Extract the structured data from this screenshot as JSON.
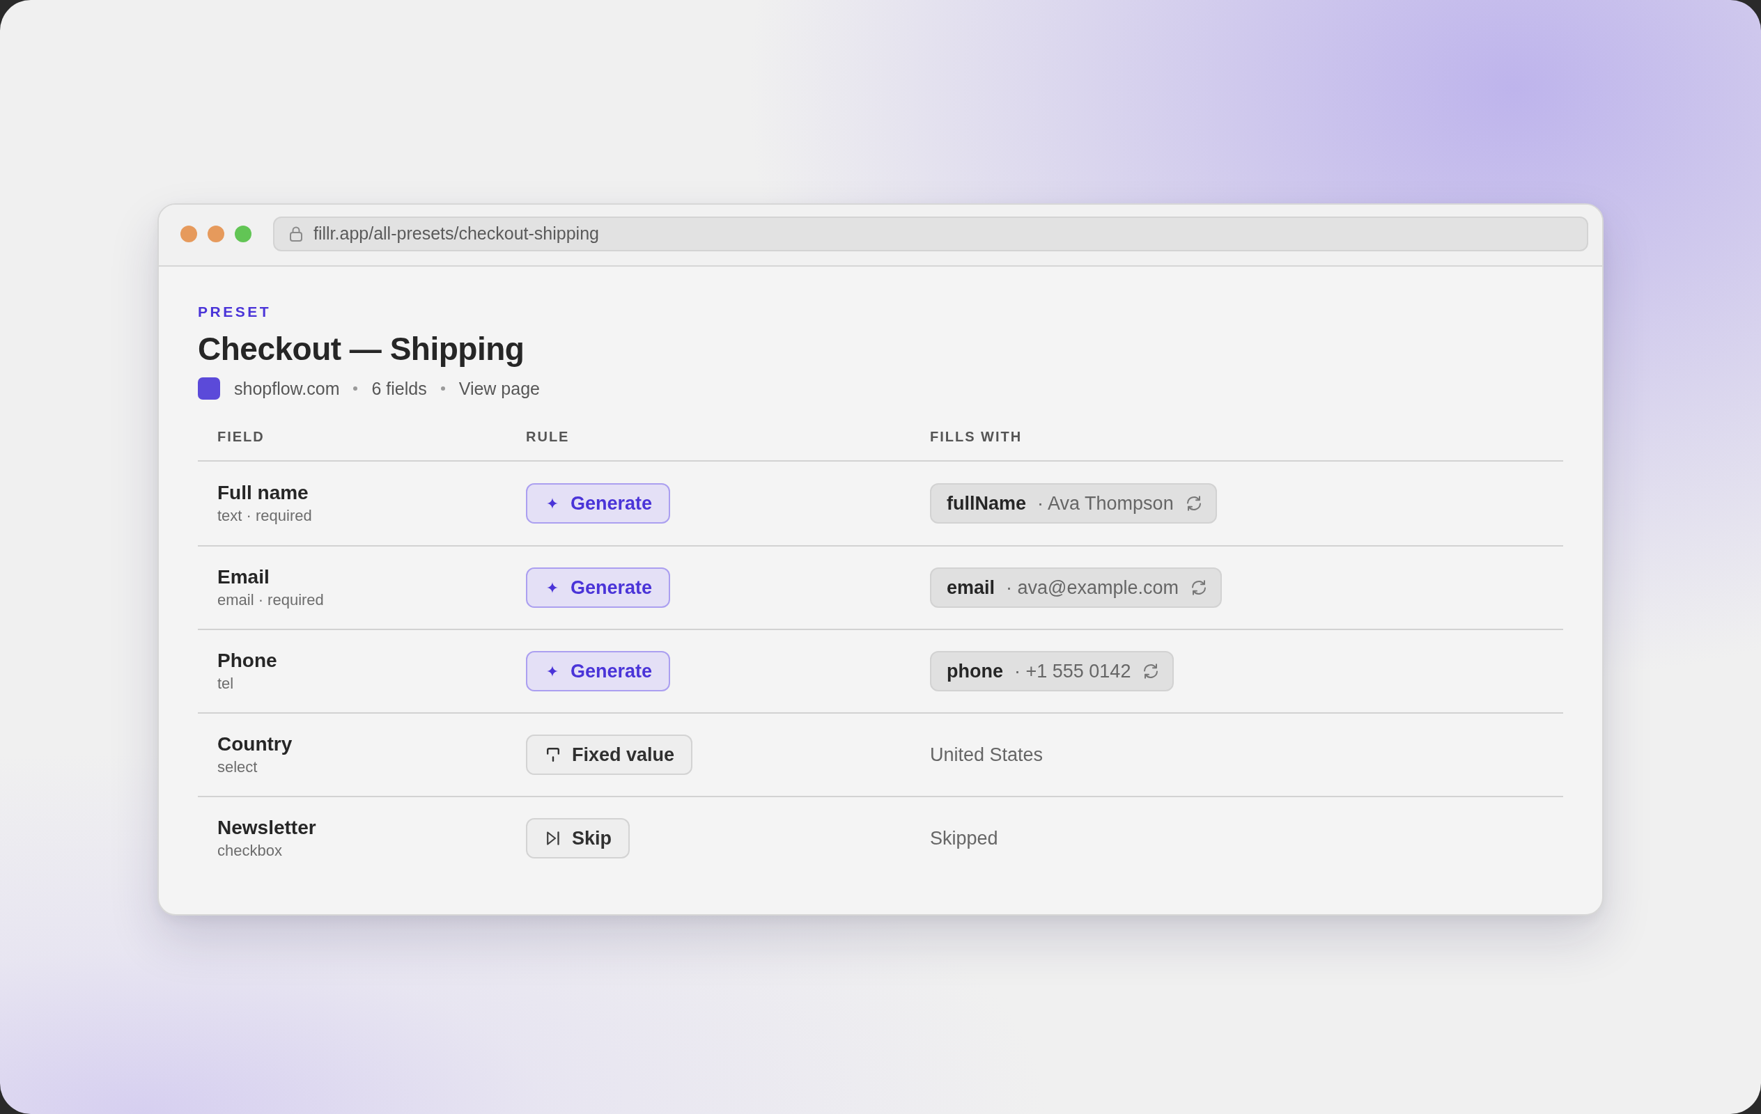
{
  "window": {
    "url": "fillr.app/all-presets/checkout-shipping"
  },
  "preset": {
    "label": "PRESET",
    "title": "Checkout — Shipping",
    "site": "shopflow.com",
    "field_count": "6 fields",
    "view_link": "View page"
  },
  "table": {
    "columns": [
      "FIELD",
      "RULE",
      "FILLS WITH"
    ],
    "rows": [
      {
        "field": {
          "name": "Full name",
          "detail": "text · required"
        },
        "rule": {
          "kind": "generate",
          "label": "Generate"
        },
        "fill": {
          "kind": "token",
          "token": "fullName",
          "sample": "· Ava Thompson"
        }
      },
      {
        "field": {
          "name": "Email",
          "detail": "email · required"
        },
        "rule": {
          "kind": "generate",
          "label": "Generate"
        },
        "fill": {
          "kind": "token",
          "token": "email",
          "sample": "· ava@example.com"
        }
      },
      {
        "field": {
          "name": "Phone",
          "detail": "tel"
        },
        "rule": {
          "kind": "generate",
          "label": "Generate"
        },
        "fill": {
          "kind": "token",
          "token": "phone",
          "sample": "· +1 555 0142"
        }
      },
      {
        "field": {
          "name": "Country",
          "detail": "select"
        },
        "rule": {
          "kind": "fixed",
          "label": "Fixed value"
        },
        "fill": {
          "kind": "text",
          "text": "United States"
        }
      },
      {
        "field": {
          "name": "Newsletter",
          "detail": "checkbox"
        },
        "rule": {
          "kind": "skip",
          "label": "Skip"
        },
        "fill": {
          "kind": "text",
          "text": "Skipped"
        }
      }
    ]
  }
}
